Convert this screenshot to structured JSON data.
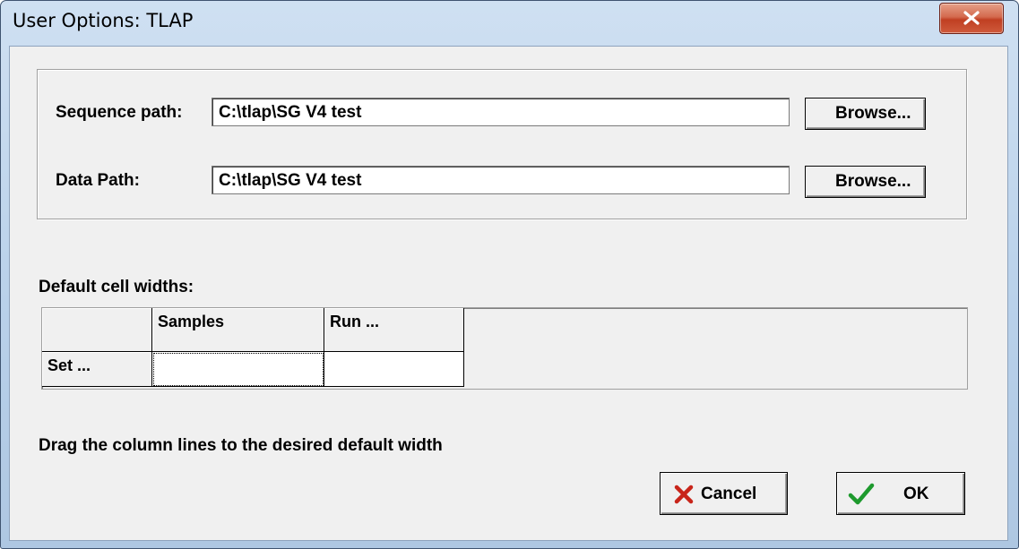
{
  "window": {
    "title": "User Options: TLAP",
    "close_icon": "close-x-icon"
  },
  "paths": {
    "sequence_label": "Sequence path:",
    "sequence_value": "C:\\tlap\\SG V4 test",
    "data_label": "Data Path:",
    "data_value": "C:\\tlap\\SG V4 test",
    "browse_label": "Browse..."
  },
  "cell_widths": {
    "heading": "Default cell widths:",
    "columns": [
      "",
      "Samples",
      "Run ..."
    ],
    "rows": [
      {
        "header": "Set ...",
        "cells": [
          "",
          ""
        ]
      }
    ],
    "hint": "Drag the column lines to the desired default width"
  },
  "buttons": {
    "cancel_label": "Cancel",
    "cancel_icon": "red-x-icon",
    "ok_label": "OK",
    "ok_icon": "green-check-icon",
    "colors": {
      "cancel_x": "#c8251a",
      "ok_check": "#1e9a2e"
    }
  }
}
